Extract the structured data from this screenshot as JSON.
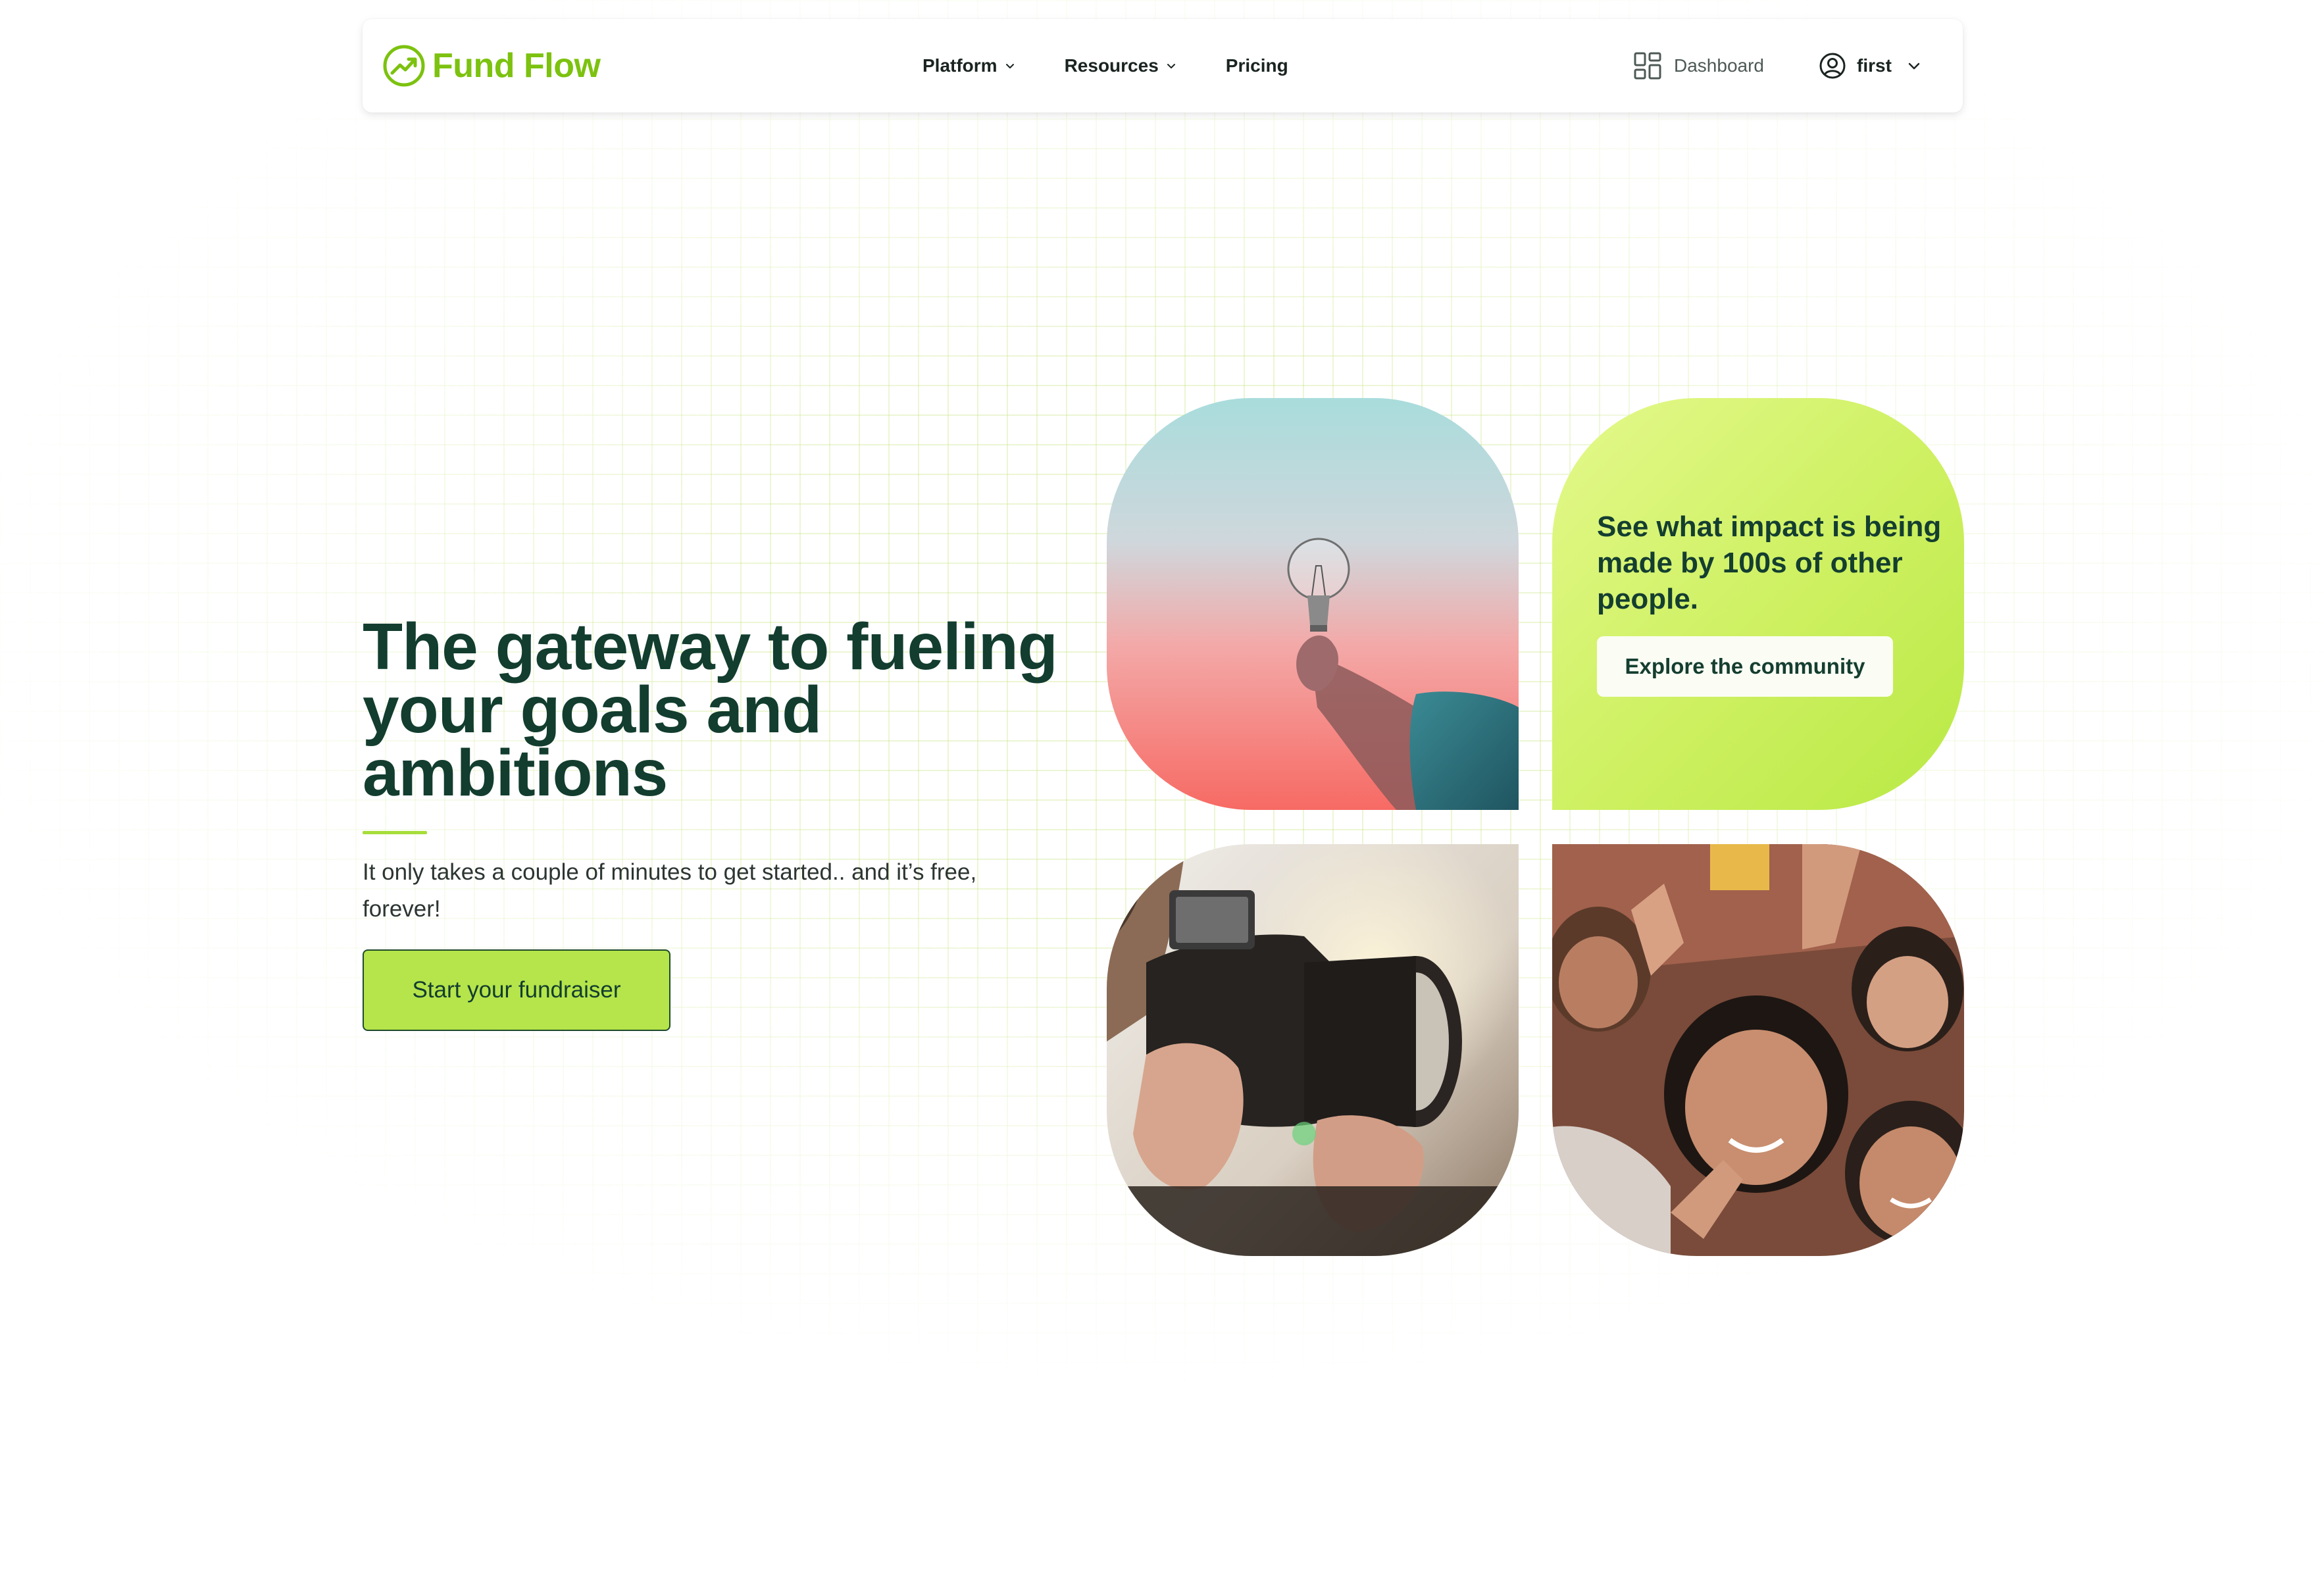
{
  "brand": {
    "name": "Fund Flow",
    "color": "#7cc20f",
    "icon": "trend-up-circle-icon"
  },
  "nav": {
    "items": [
      {
        "label": "Platform",
        "has_dropdown": true
      },
      {
        "label": "Resources",
        "has_dropdown": true
      },
      {
        "label": "Pricing",
        "has_dropdown": false
      }
    ],
    "dashboard_label": "Dashboard",
    "dashboard_icon": "grid-icon",
    "user_name": "first",
    "user_icon": "user-circle-icon"
  },
  "hero": {
    "title": "The gateway to fueling your goals and ambitions",
    "subtitle": "It only takes a couple of minutes to get started.. and it’s free, forever!",
    "cta_label": "Start your fundraiser",
    "cta_color": "#b5e54a",
    "title_color": "#123d2f"
  },
  "tiles": {
    "photo_lightbulb": "lightbulb-hand-photo",
    "community": {
      "text": "See what impact is being made by 100s of other people.",
      "button_label": "Explore the community"
    },
    "photo_camera": "camera-operator-photo",
    "photo_children": "smiling-children-photo"
  }
}
